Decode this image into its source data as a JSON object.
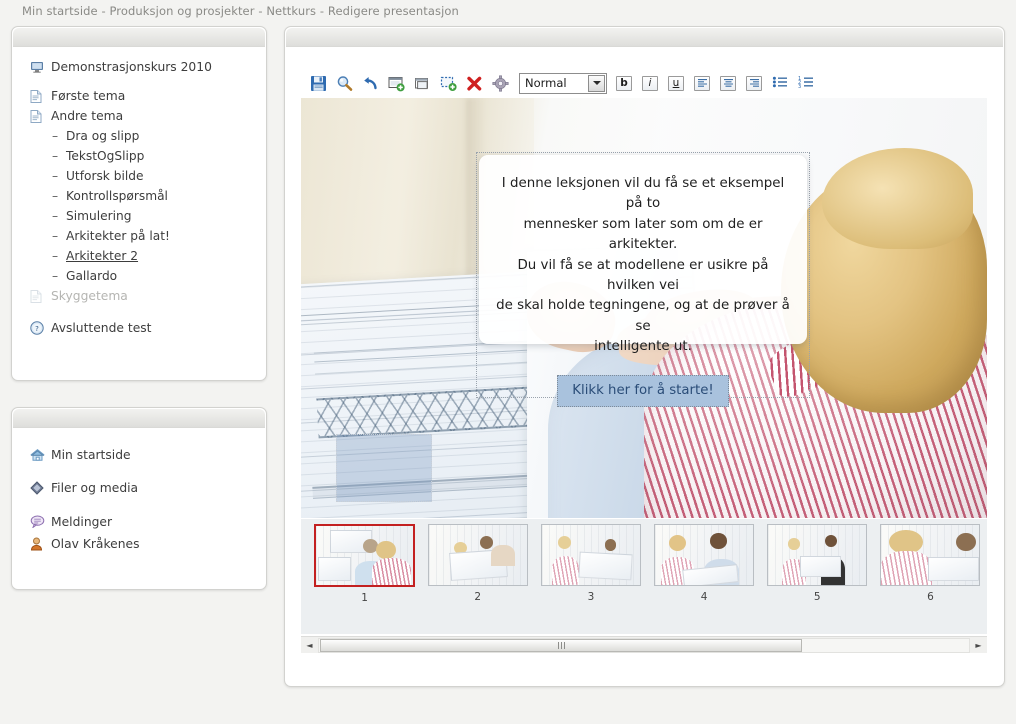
{
  "breadcrumb": "Min startside - Produksjon og prosjekter - Nettkurs - Redigere presentasjon",
  "sidebar": {
    "course": {
      "label": "Demonstrasjonskurs 2010",
      "icon": "monitor-icon"
    },
    "items": [
      {
        "label": "Første tema",
        "type": "topic",
        "icon": "document-icon"
      },
      {
        "label": "Andre tema",
        "type": "topic",
        "icon": "document-icon"
      },
      {
        "label": "Dra og slipp",
        "type": "sub"
      },
      {
        "label": "TekstOgSlipp",
        "type": "sub"
      },
      {
        "label": "Utforsk bilde",
        "type": "sub"
      },
      {
        "label": "Kontrollspørsmål",
        "type": "sub"
      },
      {
        "label": "Simulering",
        "type": "sub"
      },
      {
        "label": "Arkitekter på lat!",
        "type": "sub"
      },
      {
        "label": "Arkitekter 2",
        "type": "sub",
        "selected": true
      },
      {
        "label": "Gallardo",
        "type": "sub"
      },
      {
        "label": "Skyggetema",
        "type": "topic",
        "icon": "document-icon",
        "muted": true
      },
      {
        "label": "Avsluttende test",
        "type": "test",
        "icon": "help-icon"
      }
    ],
    "links": [
      {
        "label": "Min startside",
        "icon": "home-icon"
      },
      {
        "label": "Filer og media",
        "icon": "diamond-icon"
      },
      {
        "label": "Meldinger",
        "icon": "message-icon"
      },
      {
        "label": "Olav Kråkenes",
        "icon": "user-icon"
      }
    ]
  },
  "toolbar": {
    "buttons": [
      {
        "name": "save-button",
        "title": "Lagre"
      },
      {
        "name": "preview-button",
        "title": "Forhåndsvis"
      },
      {
        "name": "undo-button",
        "title": "Angre"
      },
      {
        "name": "add-slide-button",
        "title": "Nytt lysbilde"
      },
      {
        "name": "duplicate-button",
        "title": "Dupliser"
      },
      {
        "name": "add-region-button",
        "title": "Nytt område"
      },
      {
        "name": "delete-button",
        "title": "Slett"
      },
      {
        "name": "settings-button",
        "title": "Innstillinger"
      }
    ],
    "style_select": {
      "value": "Normal",
      "options": [
        "Normal"
      ]
    },
    "format": {
      "bold": "b",
      "italic": "i",
      "underline": "u",
      "align_left": "align-left-icon",
      "align_center": "align-center-icon",
      "align_right": "align-right-icon",
      "bullet_list": "bullet-list-icon",
      "numbered_list": "numbered-list-icon"
    }
  },
  "slide": {
    "card_text_line1": "I denne leksjonen vil du få se et eksempel på to",
    "card_text_line2": "mennesker som later som om de er arkitekter.",
    "card_text_line3": "Du vil få se at modellene er usikre på hvilken vei",
    "card_text_line4": "de skal holde tegningene, og at de prøver å se",
    "card_text_line5": "intelligente ut.",
    "cta_label": "Klikk her for å starte!"
  },
  "filmstrip": {
    "thumbnails": [
      {
        "number": "1",
        "selected": true
      },
      {
        "number": "2",
        "selected": false
      },
      {
        "number": "3",
        "selected": false
      },
      {
        "number": "4",
        "selected": false
      },
      {
        "number": "5",
        "selected": false
      },
      {
        "number": "6",
        "selected": false
      }
    ]
  },
  "scrollbar": {
    "left_arrow": "◄",
    "right_arrow": "►"
  },
  "colors": {
    "selection_red": "#c32020",
    "cta_blue": "#a9c2dd",
    "accent_text": "#2b4d78"
  }
}
